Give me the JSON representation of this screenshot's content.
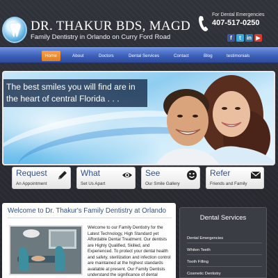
{
  "header": {
    "title": "DR. THAKUR BDS, MAGD",
    "subtitle": "Family Dentistry in Orlando on Curry Ford Road",
    "emergency_label": "For Dental Emergencies",
    "emergency_phone": "407-517-0250",
    "social_icons": [
      "facebook-icon",
      "twitter-icon",
      "linkedin-icon",
      "youtube-icon"
    ]
  },
  "nav": {
    "items": [
      {
        "label": "Home",
        "active": true
      },
      {
        "label": "About"
      },
      {
        "label": "Doctors"
      },
      {
        "label": "Dental Services"
      },
      {
        "label": "Contact"
      },
      {
        "label": "Blog"
      },
      {
        "label": "testimonials"
      }
    ]
  },
  "hero": {
    "line1": "The best smiles you will find are in",
    "line2": "the heart of central Florida . . ."
  },
  "features": [
    {
      "title": "Request",
      "sub": "An Appointment",
      "icon": "pencil-icon"
    },
    {
      "title": "What",
      "sub": "Set Us Apart",
      "icon": "eye-icon"
    },
    {
      "title": "See",
      "sub": "Our Smile Gallery",
      "icon": "smiley-icon"
    },
    {
      "title": "Refer",
      "sub": "Friends and Family",
      "icon": "envelope-icon"
    }
  ],
  "main": {
    "heading": "Welcome to Dr. Thakur's Family Dentistry at Orlando",
    "body": "Welcome to our Family Dentistry for the Latest Technology, High Standard yet Affordable Dental Treatment. Our dentists are Highly Qualified, Skilled, and Experienced. To protect your dental health and safety, sterilization and infection control are maintained at the highest standards available at present. Our Family Dentists understand the significance of dental"
  },
  "sidebar": {
    "title": "Dental Services",
    "items": [
      "Dental Emergencies",
      "Whiten Teeth",
      "Tooth Filling",
      "Cosmetic Dentistry"
    ]
  },
  "colors": {
    "nav_blue": "#3d5fb8",
    "active_orange": "#e07e22",
    "heading_blue": "#2e4f8f",
    "background": "#2a2d34"
  }
}
